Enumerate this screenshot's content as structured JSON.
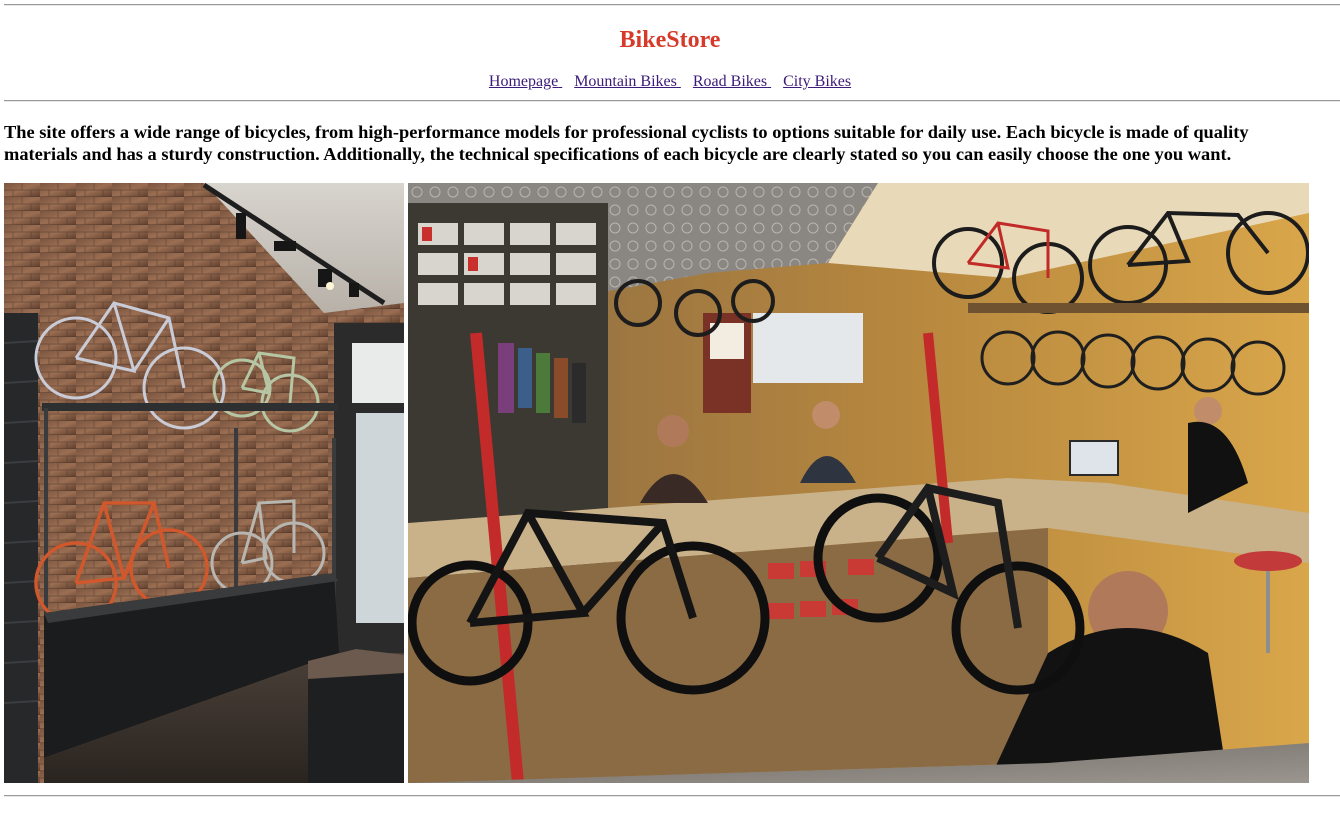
{
  "site": {
    "title": "BikeStore",
    "brand_color": "#d63a2a"
  },
  "nav": {
    "items": [
      {
        "label": "Homepage"
      },
      {
        "label": "Mountain Bikes"
      },
      {
        "label": "Road Bikes"
      },
      {
        "label": "City Bikes"
      }
    ],
    "link_color": "#3b1a78"
  },
  "intro": {
    "text": "The site offers a wide range of bicycles, from high-performance models for professional cyclists to options suitable for daily use. Each bicycle is made of quality materials and has a sturdy construction. Additionally, the technical specifications of each bicycle are clearly stated so you can easily choose the one you want."
  },
  "gallery": {
    "images": [
      {
        "subject": "bike shop showroom with bicycles mounted on brick wall and display case"
      },
      {
        "subject": "busy bike shop interior with staff, workstand bicycles and stocked shelves"
      }
    ]
  }
}
